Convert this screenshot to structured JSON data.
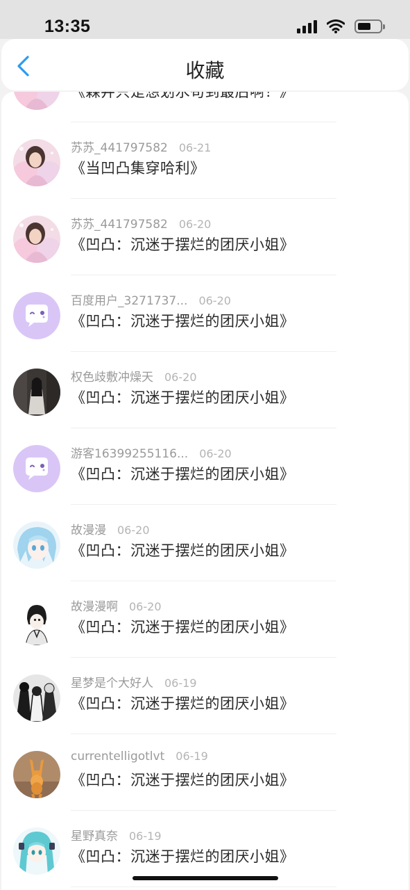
{
  "status_bar": {
    "time": "13:35"
  },
  "header": {
    "title": "收藏"
  },
  "items": [
    {
      "username": "",
      "date": "",
      "novel": "《森井只是想划水苟到最后啊！》",
      "avatar": "pink-girl"
    },
    {
      "username": "苏苏_441797582",
      "date": "06-21",
      "novel": "《当凹凸集穿哈利》",
      "avatar": "pink-girl"
    },
    {
      "username": "苏苏_441797582",
      "date": "06-20",
      "novel": "《凹凸：沉迷于摆烂的团厌小姐》",
      "avatar": "pink-girl"
    },
    {
      "username": "百度用户_3271737...",
      "date": "06-20",
      "novel": "《凹凸：沉迷于摆烂的团厌小姐》",
      "avatar": "default-chat"
    },
    {
      "username": "权色歧敷冲燥天",
      "date": "06-20",
      "novel": "《凹凸：沉迷于摆烂的团厌小姐》",
      "avatar": "dark-ghost"
    },
    {
      "username": "游客16399255116...",
      "date": "06-20",
      "novel": "《凹凸：沉迷于摆烂的团厌小姐》",
      "avatar": "default-chat"
    },
    {
      "username": "故漫漫",
      "date": "06-20",
      "novel": "《凹凸：沉迷于摆烂的团厌小姐》",
      "avatar": "blue-anime"
    },
    {
      "username": "故漫漫啊",
      "date": "06-20",
      "novel": "《凹凸：沉迷于摆烂的团厌小姐》",
      "avatar": "sketch-boy"
    },
    {
      "username": "星梦是个大好人",
      "date": "06-19",
      "novel": "《凹凸：沉迷于摆烂的团厌小姐》",
      "avatar": "bw-group"
    },
    {
      "username": "currentelligotlvt",
      "date": "06-19",
      "novel": "《凹凸：沉迷于摆烂的团厌小姐》",
      "avatar": "orange-cat"
    },
    {
      "username": "星野真奈",
      "date": "06-19",
      "novel": "《凹凸：沉迷于摆烂的团厌小姐》",
      "avatar": "miku"
    }
  ],
  "colors": {
    "accent": "#2d9bf0",
    "default_avatar": "#d9c6f7"
  }
}
